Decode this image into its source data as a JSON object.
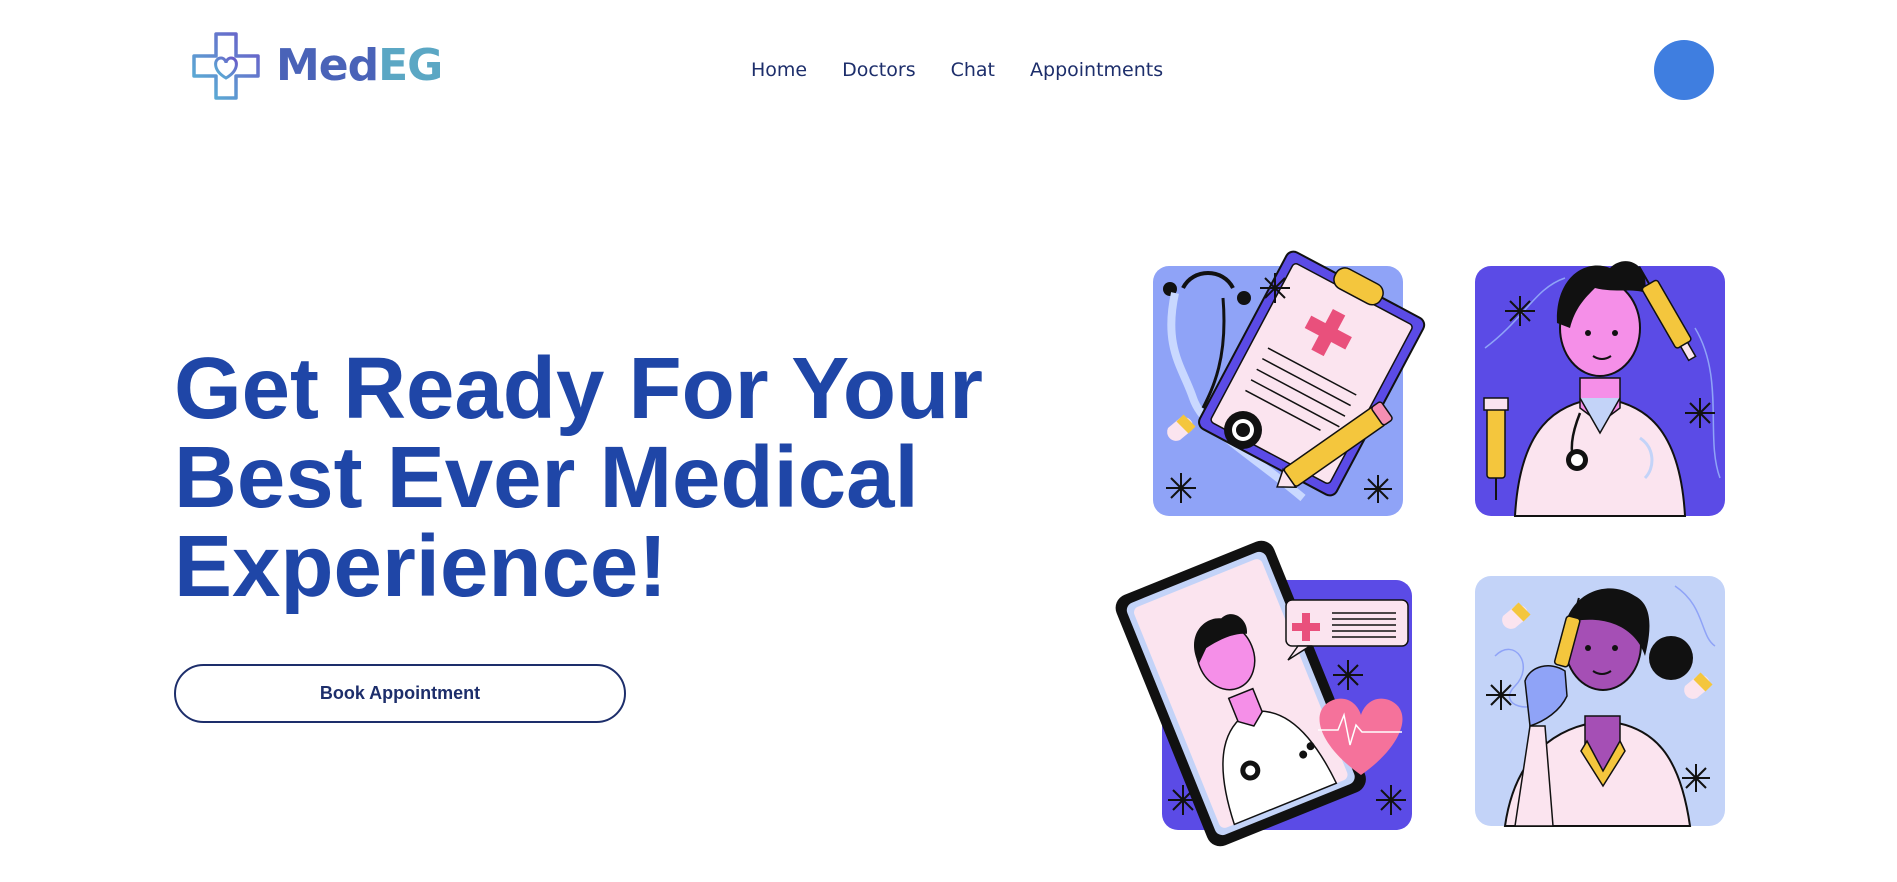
{
  "brand": {
    "name_part1": "Med",
    "name_part2": "EG"
  },
  "nav": {
    "items": [
      {
        "label": "Home"
      },
      {
        "label": "Doctors"
      },
      {
        "label": "Chat"
      },
      {
        "label": "Appointments"
      }
    ]
  },
  "hero": {
    "title_lines": [
      "Get Ready For Your",
      "Best Ever Medical",
      "Experience!"
    ],
    "cta_label": "Book Appointment"
  },
  "colors": {
    "primary": "#1f46a7",
    "nav_text": "#1d2e6b",
    "avatar": "#3f7ee0",
    "illustration_violet": "#5b4be6",
    "illustration_periwinkle": "#8fa3f7",
    "illustration_light": "#c3d3f8"
  },
  "illustrations": [
    {
      "icon": "clipboard-stethoscope-illustration"
    },
    {
      "icon": "male-doctor-illustration"
    },
    {
      "icon": "phone-doctor-chat-illustration"
    },
    {
      "icon": "female-nurse-vaccine-illustration"
    }
  ]
}
